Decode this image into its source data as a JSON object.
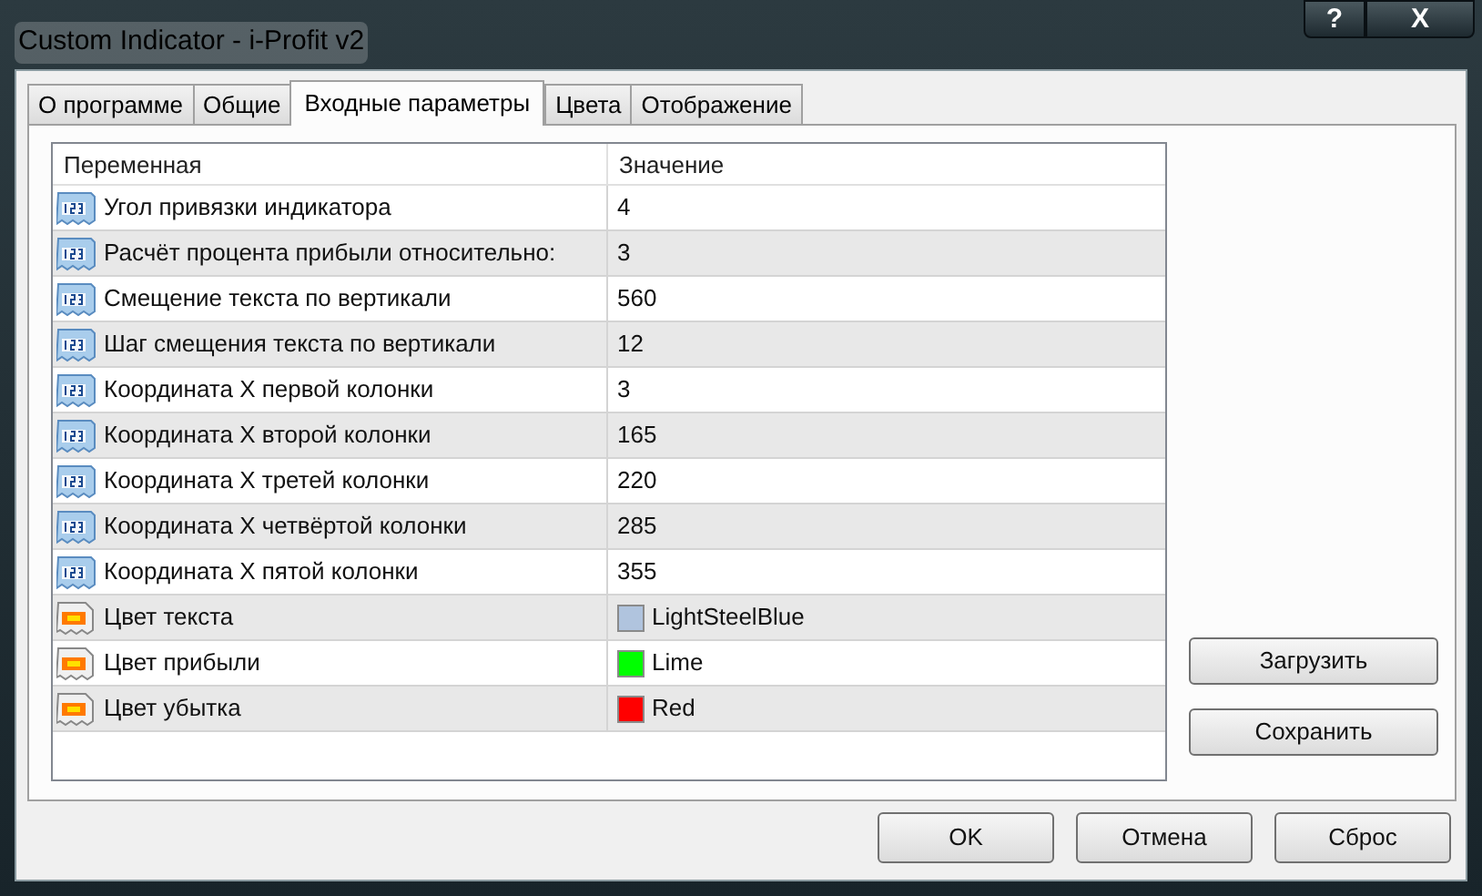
{
  "window": {
    "title": "Custom Indicator - i-Profit v2",
    "title_buttons": [
      "?",
      "X"
    ]
  },
  "tabs": [
    {
      "label": "О программе",
      "selected": false
    },
    {
      "label": "Общие",
      "selected": false
    },
    {
      "label": "Входные параметры",
      "selected": true
    },
    {
      "label": "Цвета",
      "selected": false
    },
    {
      "label": "Отображение",
      "selected": false
    }
  ],
  "table": {
    "columns": [
      "Переменная",
      "Значение"
    ],
    "rows": [
      {
        "kind": "number",
        "variable": "Угол привязки индикатора",
        "value": "4"
      },
      {
        "kind": "number",
        "variable": "Расчёт процента прибыли относительно:",
        "value": "3"
      },
      {
        "kind": "number",
        "variable": "Смещение текста по вертикали",
        "value": "560"
      },
      {
        "kind": "number",
        "variable": "Шаг смещения текста по вертикали",
        "value": "12"
      },
      {
        "kind": "number",
        "variable": "Координата X первой колонки",
        "value": "3"
      },
      {
        "kind": "number",
        "variable": "Координата X второй колонки",
        "value": "165"
      },
      {
        "kind": "number",
        "variable": "Координата X третей колонки",
        "value": "220"
      },
      {
        "kind": "number",
        "variable": "Координата X четвёртой колонки",
        "value": "285"
      },
      {
        "kind": "number",
        "variable": "Координата X пятой колонки",
        "value": "355"
      },
      {
        "kind": "color",
        "variable": "Цвет текста",
        "value": "LightSteelBlue",
        "color": "#b0c4de"
      },
      {
        "kind": "color",
        "variable": "Цвет прибыли",
        "value": "Lime",
        "color": "#00ff00"
      },
      {
        "kind": "color",
        "variable": "Цвет убытка",
        "value": "Red",
        "color": "#ff0000"
      }
    ]
  },
  "side_buttons": [
    "Загрузить",
    "Сохранить"
  ],
  "buttons": [
    "OK",
    "Отмена",
    "Сброс"
  ]
}
